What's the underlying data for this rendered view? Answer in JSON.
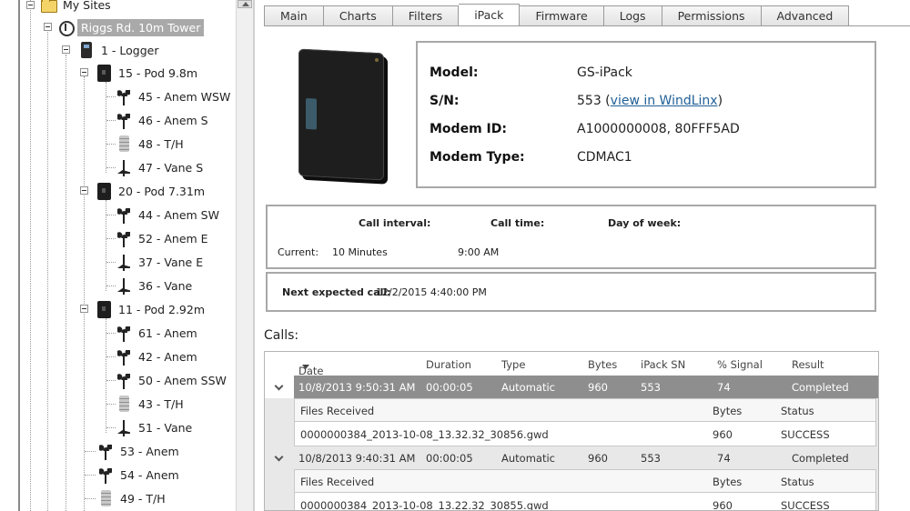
{
  "tree": {
    "nodes": [
      {
        "label": "My Sites",
        "icon": "folder-icon"
      },
      {
        "label": "Riggs Rd. 10m Tower",
        "icon": "tower-icon"
      },
      {
        "label": "1 - Logger",
        "icon": "logger-icon"
      },
      {
        "label": "15 - Pod 9.8m",
        "icon": "pod-icon"
      },
      {
        "label": "45 - Anem WSW",
        "icon": "anemometer-icon"
      },
      {
        "label": "46 - Anem S",
        "icon": "anemometer-icon"
      },
      {
        "label": "48 - T/H",
        "icon": "temp-humidity-icon"
      },
      {
        "label": "47 - Vane S",
        "icon": "vane-icon"
      },
      {
        "label": "20 - Pod 7.31m",
        "icon": "pod-icon"
      },
      {
        "label": "44 - Anem SW",
        "icon": "anemometer-icon"
      },
      {
        "label": "52 - Anem E",
        "icon": "anemometer-icon"
      },
      {
        "label": "37 - Vane E",
        "icon": "vane-icon"
      },
      {
        "label": "36 - Vane",
        "icon": "vane-icon"
      },
      {
        "label": "11 - Pod 2.92m",
        "icon": "pod-icon"
      },
      {
        "label": "61 - Anem",
        "icon": "anemometer-icon"
      },
      {
        "label": "42 - Anem",
        "icon": "anemometer-icon"
      },
      {
        "label": "50 - Anem SSW",
        "icon": "anemometer-icon"
      },
      {
        "label": "43 - T/H",
        "icon": "temp-humidity-icon"
      },
      {
        "label": "51 - Vane",
        "icon": "vane-icon"
      },
      {
        "label": "53 - Anem",
        "icon": "anemometer-icon"
      },
      {
        "label": "54 - Anem",
        "icon": "anemometer-icon"
      },
      {
        "label": "49 - T/H",
        "icon": "temp-humidity-icon"
      }
    ]
  },
  "tabs": [
    "Main",
    "Charts",
    "Filters",
    "iPack",
    "Firmware",
    "Logs",
    "Permissions",
    "Advanced"
  ],
  "active_tab": "iPack",
  "device": {
    "model_label": "Model:",
    "model": "GS-iPack",
    "sn_label": "S/N:",
    "sn": "553",
    "sn_link": "view in WindLinx",
    "sn_open": " (",
    "sn_close": ")",
    "modem_id_label": "Modem ID:",
    "modem_id": "A1000000008, 80FFF5AD",
    "modem_type_label": "Modem Type:",
    "modem_type": "CDMAC1"
  },
  "schedule": {
    "call_interval_label": "Call interval:",
    "call_time_label": "Call time:",
    "day_of_week_label": "Day of week:",
    "current_label": "Current:",
    "current_interval": "10 Minutes",
    "current_time": "9:00 AM",
    "next_label": "Next expected call:",
    "next_value": "12/2/2015 4:40:00 PM"
  },
  "calls": {
    "title": "Calls:",
    "columns": [
      "Date",
      "Duration",
      "Type",
      "Bytes",
      "iPack SN",
      "% Signal",
      "Result"
    ],
    "sub_columns": [
      "Files Received",
      "Bytes",
      "Status"
    ],
    "rows": [
      {
        "date": "10/8/2013 9:50:31 AM",
        "duration": "00:00:05",
        "type": "Automatic",
        "bytes": "960",
        "ipack_sn": "553",
        "signal": "74",
        "result": "Completed",
        "file": "0000000384_2013-10-08_13.32.32_30856.gwd",
        "file_bytes": "960",
        "file_status": "SUCCESS"
      },
      {
        "date": "10/8/2013 9:40:31 AM",
        "duration": "00:00:05",
        "type": "Automatic",
        "bytes": "960",
        "ipack_sn": "553",
        "signal": "74",
        "result": "Completed",
        "file": "0000000384_2013-10-08_13.22.32_30855.gwd",
        "file_bytes": "960",
        "file_status": "SUCCESS"
      }
    ]
  }
}
